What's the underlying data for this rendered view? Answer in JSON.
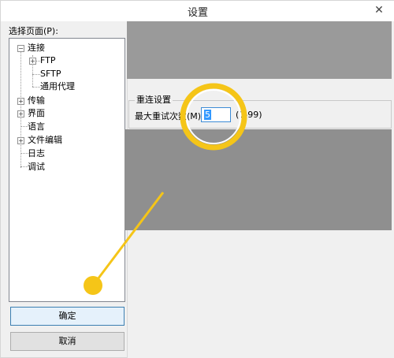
{
  "window": {
    "title": "设置",
    "close_glyph": "✕"
  },
  "tree": {
    "label": "选择页面(P):",
    "nodes": {
      "connection": "连接",
      "ftp": "FTP",
      "sftp": "SFTP",
      "proxy": "通用代理",
      "transfer": "传输",
      "interface": "界面",
      "language": "语言",
      "editing": "文件编辑",
      "log": "日志",
      "debug": "调试"
    },
    "expander_minus": "−",
    "expander_plus": "+"
  },
  "buttons": {
    "ok": "确定",
    "cancel": "取消"
  },
  "reconnect": {
    "group_title": "重连设置",
    "max_retries_label": "最大重试次数(M):",
    "max_retries_value": "5",
    "range_hint": "(0-99)"
  },
  "colors": {
    "highlight_ring": "#f5c518",
    "callout_dot": "#f5c518",
    "selection": "#3399ff",
    "dim_overlay": "#8f8f8f"
  }
}
